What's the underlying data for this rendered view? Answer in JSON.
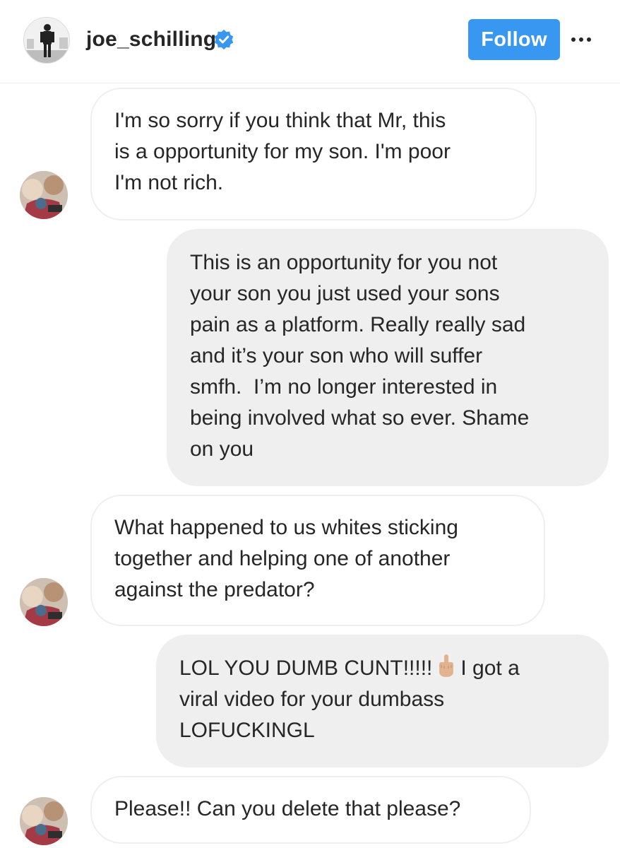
{
  "header": {
    "username": "joe_schilling",
    "verified_icon": "verified-badge-icon",
    "follow_label": "Follow",
    "more_icon": "more-options-icon",
    "accent_color": "#3897f0"
  },
  "messages": [
    {
      "sender": "incoming",
      "text": "I'm so sorry if you think that Mr, this\nis a opportunity for my son. I'm poor\nI'm not rich."
    },
    {
      "sender": "outgoing",
      "text": "This is an opportunity for you not\nyour son you just used your sons\npain as a platform. Really really sad\nand it’s your son who will suffer\nsmfh.  I’m no longer interested in\nbeing involved what so ever. Shame\non you"
    },
    {
      "sender": "incoming",
      "text": "What happened to us whites sticking\ntogether and helping one of another\nagainst the predator?"
    },
    {
      "sender": "outgoing",
      "text_before_emoji": "LOL YOU DUMB CUNT!!!!!",
      "emoji": "middle-finger-emoji",
      "text_after_emoji": "I got a\nviral video for your dumbass\nLOFUCKINGL"
    },
    {
      "sender": "incoming",
      "text": "Please!! Can you delete that please?"
    }
  ]
}
